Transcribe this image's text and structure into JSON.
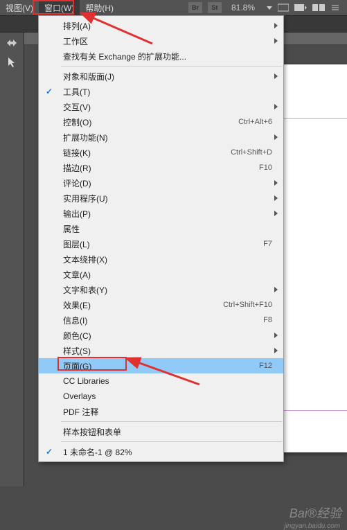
{
  "menubar": {
    "items": [
      "视图(V)",
      "窗口(W)",
      "帮助(H)"
    ],
    "active_index": 1,
    "right": {
      "br": "Br",
      "st": "St",
      "zoom": "81.8%"
    }
  },
  "dropdown": {
    "groups": [
      [
        {
          "label": "排列(A)",
          "submenu": true
        },
        {
          "label": "工作区",
          "submenu": true
        },
        {
          "label": "查找有关 Exchange 的扩展功能..."
        }
      ],
      [
        {
          "label": "对象和版面(J)",
          "submenu": true
        },
        {
          "label": "工具(T)",
          "checked": true
        },
        {
          "label": "交互(V)",
          "submenu": true
        },
        {
          "label": "控制(O)",
          "shortcut": "Ctrl+Alt+6"
        },
        {
          "label": "扩展功能(N)",
          "submenu": true
        },
        {
          "label": "链接(K)",
          "shortcut": "Ctrl+Shift+D"
        },
        {
          "label": "描边(R)",
          "shortcut": "F10"
        },
        {
          "label": "评论(D)",
          "submenu": true
        },
        {
          "label": "实用程序(U)",
          "submenu": true
        },
        {
          "label": "输出(P)",
          "submenu": true
        },
        {
          "label": "属性"
        },
        {
          "label": "图层(L)",
          "shortcut": "F7"
        },
        {
          "label": "文本绕排(X)"
        },
        {
          "label": "文章(A)"
        },
        {
          "label": "文字和表(Y)",
          "submenu": true
        },
        {
          "label": "效果(E)",
          "shortcut": "Ctrl+Shift+F10"
        },
        {
          "label": "信息(I)",
          "shortcut": "F8"
        },
        {
          "label": "颜色(C)",
          "submenu": true
        },
        {
          "label": "样式(S)",
          "submenu": true
        },
        {
          "label": "页面(G)",
          "shortcut": "F12",
          "highlighted": true
        },
        {
          "label": "CC Libraries"
        },
        {
          "label": "Overlays"
        },
        {
          "label": "PDF 注释"
        }
      ],
      [
        {
          "label": "样本按钮和表单"
        }
      ],
      [
        {
          "label": "1 未命名-1 @ 82%",
          "checked": true
        }
      ]
    ]
  },
  "watermark": {
    "main": "Bai®经验",
    "sub": "jingyan.baidu.com"
  }
}
